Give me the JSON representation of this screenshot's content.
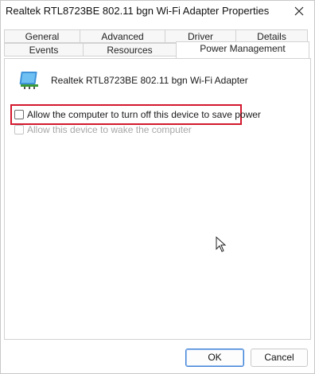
{
  "window": {
    "title": "Realtek RTL8723BE 802.11 bgn Wi-Fi Adapter Properties"
  },
  "tabs": {
    "row1": [
      "General",
      "Advanced",
      "Driver",
      "Details"
    ],
    "row2": [
      "Events",
      "Resources",
      "Power Management"
    ],
    "active": "Power Management"
  },
  "device": {
    "name": "Realtek RTL8723BE 802.11 bgn Wi-Fi Adapter",
    "icon": "network-adapter-icon"
  },
  "options": [
    {
      "label": "Allow the computer to turn off this device to save power",
      "checked": false,
      "enabled": true,
      "highlighted": true
    },
    {
      "label": "Allow this device to wake the computer",
      "checked": false,
      "enabled": false
    }
  ],
  "buttons": {
    "ok": "OK",
    "cancel": "Cancel"
  },
  "colors": {
    "highlight": "#d3182d",
    "accent": "#3d7fd6"
  }
}
